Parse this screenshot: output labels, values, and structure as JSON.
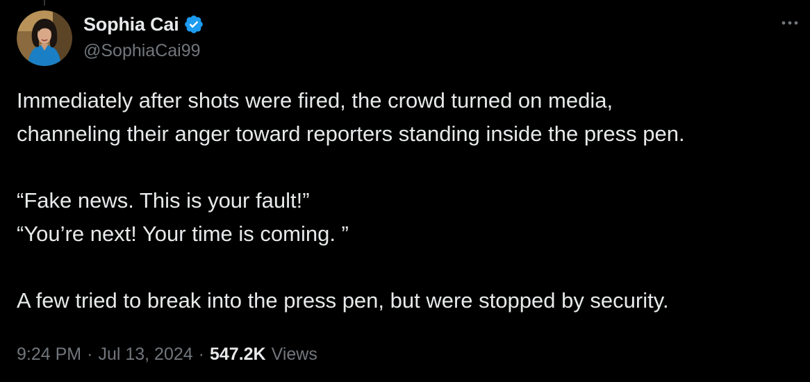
{
  "colors": {
    "background": "#000000",
    "primary_text": "#e7e9ea",
    "secondary_text": "#71767b",
    "verified_badge": "#1d9bf0"
  },
  "author": {
    "display_name": "Sophia Cai",
    "handle": "@SophiaCai99",
    "verified": true,
    "avatar_icon": "profile-photo"
  },
  "menu": {
    "icon": "more-horizontal-icon"
  },
  "tweet": {
    "lines": [
      "Immediately after shots were fired, the crowd turned on media,",
      "channeling their anger toward reporters standing inside the press pen.",
      "",
      "“Fake news. This is your fault!”",
      "“You’re next! Your time is coming. ”",
      "",
      "A few tried to break into the press pen, but were stopped by security."
    ]
  },
  "meta": {
    "time": "9:24 PM",
    "separator": "·",
    "date": "Jul 13, 2024",
    "views_count": "547.2K",
    "views_label": "Views"
  }
}
